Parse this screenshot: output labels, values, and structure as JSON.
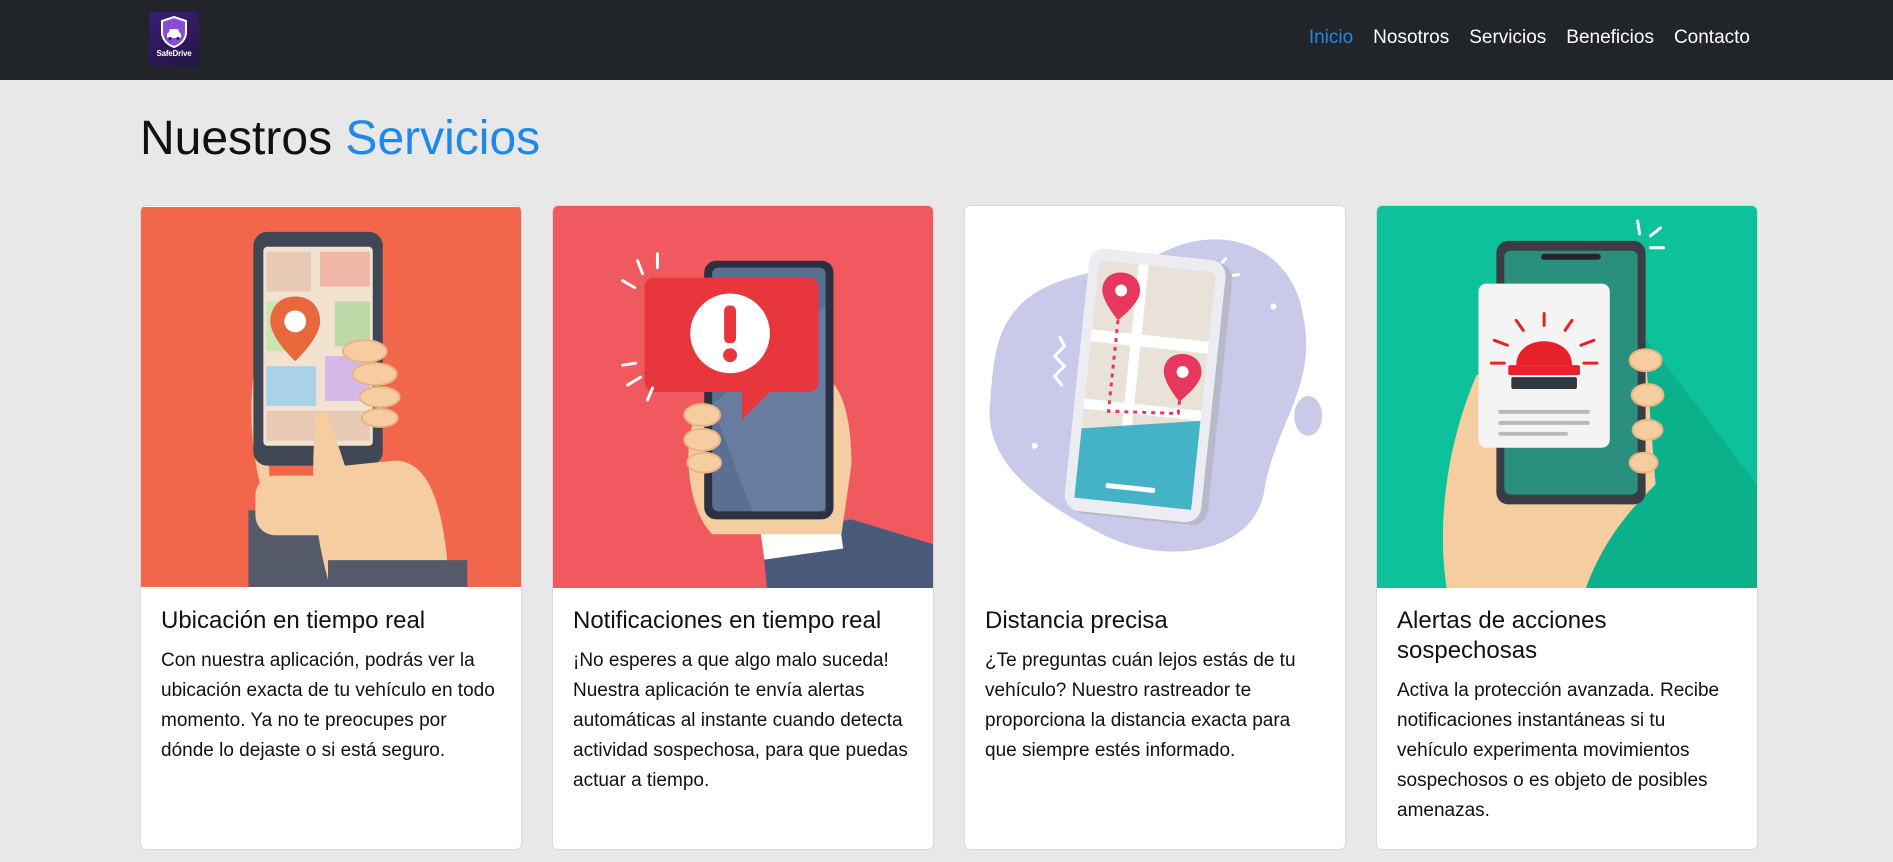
{
  "brand": {
    "logo_text": "SafeDrive"
  },
  "nav": {
    "items": [
      {
        "label": "Inicio",
        "active": true
      },
      {
        "label": "Nosotros",
        "active": false
      },
      {
        "label": "Servicios",
        "active": false
      },
      {
        "label": "Beneficios",
        "active": false
      },
      {
        "label": "Contacto",
        "active": false
      }
    ]
  },
  "section": {
    "title_plain": "Nuestros",
    "title_accent": "Servicios"
  },
  "cards": [
    {
      "title": "Ubicación en tiempo real",
      "text": "Con nuestra aplicación, podrás ver la ubicación exacta de tu vehículo en todo momento. Ya no te preocupes por dónde lo dejaste o si está seguro.",
      "image": "hand-phone-map-pin-illustration",
      "bg_color": "#f2664b"
    },
    {
      "title": "Notificaciones en tiempo real",
      "text": "¡No esperes a que algo malo suceda! Nuestra aplicación te envía alertas automáticas al instante cuando detecta actividad sospechosa, para que puedas actuar a tiempo.",
      "image": "phone-alert-notification-illustration",
      "bg_color": "#f0595e"
    },
    {
      "title": "Distancia precisa",
      "text": "¿Te preguntas cuán lejos estás de tu vehículo? Nuestro rastreador te proporciona la distancia exacta para que siempre estés informado.",
      "image": "phone-route-map-illustration",
      "bg_color": "#ffffff"
    },
    {
      "title": "Alertas de acciones sospechosas",
      "text": "Activa la protección avanzada. Recibe notificaciones instantáneas si tu vehículo experimenta movimientos sospechosos o es objeto de posibles amenazas.",
      "image": "phone-siren-alert-illustration",
      "bg_color": "#0dc29a"
    }
  ],
  "colors": {
    "accent": "#1e88ef",
    "navbar": "#212429",
    "page_bg": "#e8e8e8"
  }
}
